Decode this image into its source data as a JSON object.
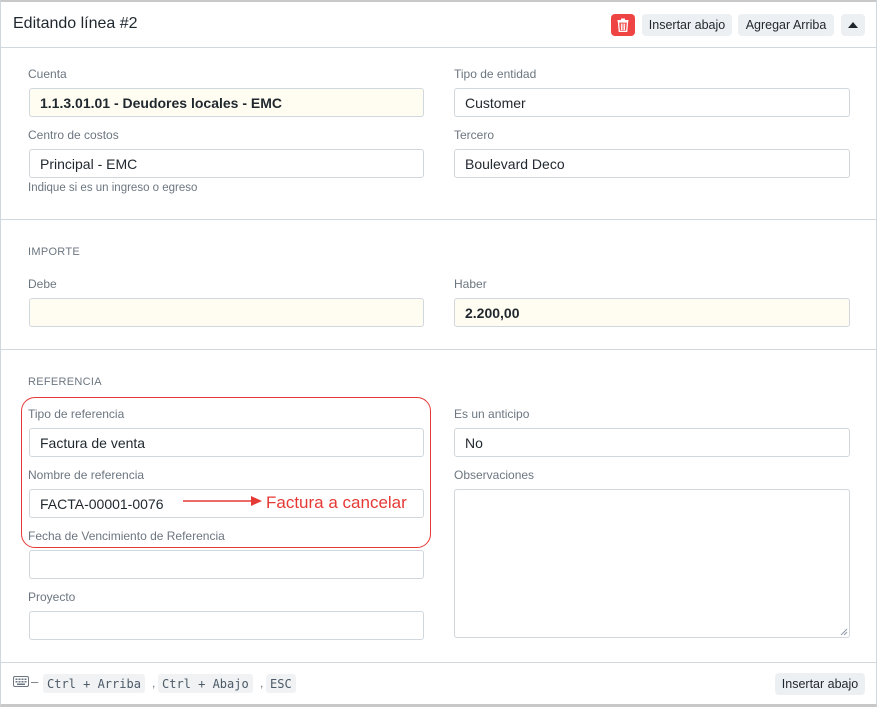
{
  "header": {
    "title": "Editando línea #2",
    "insert_below_label": "Insertar abajo",
    "add_above_label": "Agregar Arriba"
  },
  "fields": {
    "cuenta": {
      "label": "Cuenta",
      "value": "1.1.3.01.01 - Deudores locales - EMC"
    },
    "tipo_entidad": {
      "label": "Tipo de entidad",
      "value": "Customer"
    },
    "centro_costos": {
      "label": "Centro de costos",
      "value": "Principal - EMC",
      "help": "Indique si es un ingreso o egreso"
    },
    "tercero": {
      "label": "Tercero",
      "value": "Boulevard Deco"
    }
  },
  "importe": {
    "heading": "IMPORTE",
    "debe": {
      "label": "Debe",
      "value": ""
    },
    "haber": {
      "label": "Haber",
      "value": "2.200,00"
    }
  },
  "referencia": {
    "heading": "REFERENCIA",
    "tipo": {
      "label": "Tipo de referencia",
      "value": "Factura de venta"
    },
    "nombre": {
      "label": "Nombre de referencia",
      "value": "FACTA-00001-0076"
    },
    "fecha_venc": {
      "label": "Fecha de Vencimiento de Referencia",
      "value": ""
    },
    "proyecto": {
      "label": "Proyecto",
      "value": ""
    },
    "anticipo": {
      "label": "Es un anticipo",
      "value": "No"
    },
    "observaciones": {
      "label": "Observaciones",
      "value": ""
    }
  },
  "annotation": {
    "text": "Factura a cancelar",
    "color": "#e53935"
  },
  "footer": {
    "dash": "–",
    "shortcuts": [
      "Ctrl + Arriba",
      "Ctrl + Abajo",
      "ESC"
    ],
    "insert_below_label": "Insertar abajo"
  },
  "colors": {
    "delete_button": "#ef4444",
    "highlight_field": "#fffdf2",
    "border": "#d1d8dd"
  }
}
